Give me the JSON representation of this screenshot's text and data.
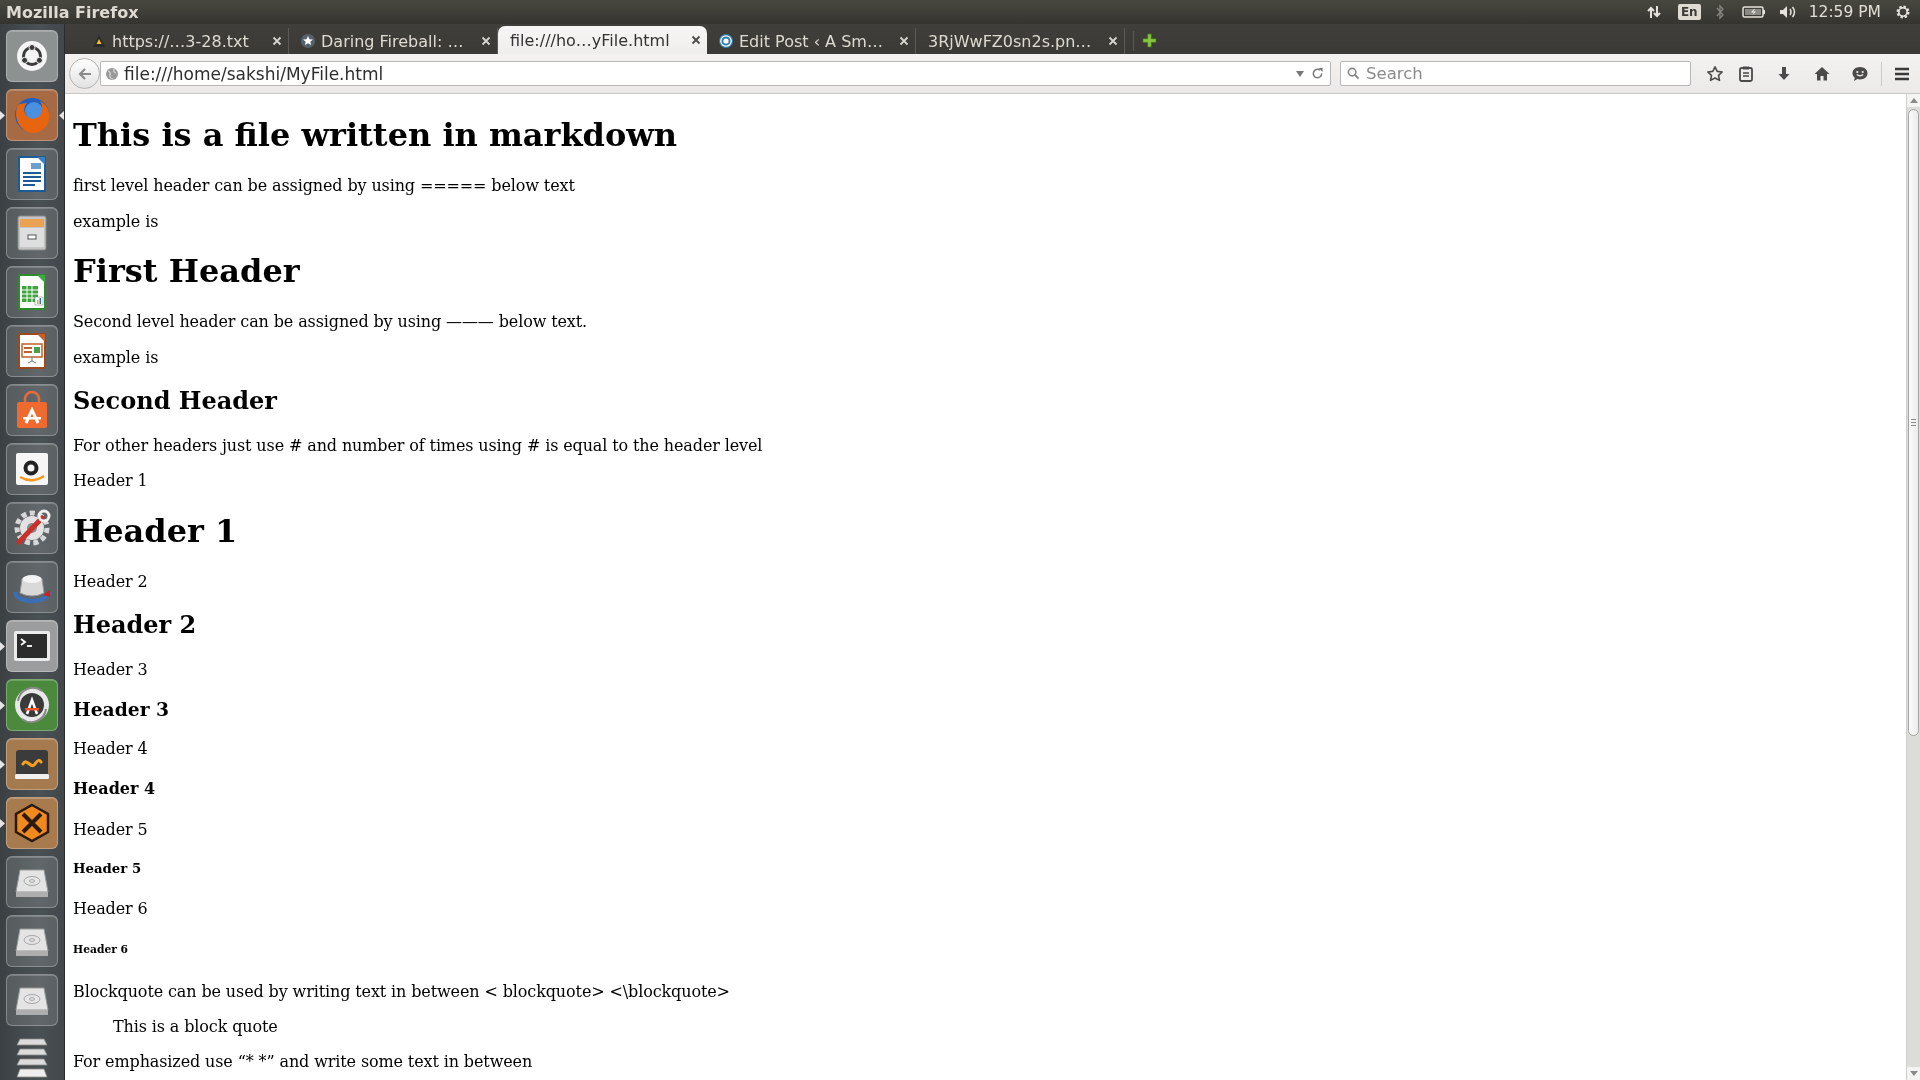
{
  "top_panel": {
    "title": "Mozilla Firefox",
    "keyboard_layout": "En",
    "time": "12:59 PM"
  },
  "launcher": [
    {
      "running": false,
      "focused": false
    },
    {
      "running": true,
      "focused": true
    },
    {
      "running": false,
      "focused": false
    },
    {
      "running": false,
      "focused": false
    },
    {
      "running": false,
      "focused": false
    },
    {
      "running": false,
      "focused": false
    },
    {
      "running": false,
      "focused": false
    },
    {
      "running": false,
      "focused": false
    },
    {
      "running": false,
      "focused": false
    },
    {
      "running": false,
      "focused": false
    },
    {
      "running": true,
      "focused": false
    },
    {
      "running": true,
      "focused": false
    },
    {
      "running": true,
      "focused": false
    },
    {
      "running": true,
      "focused": false
    },
    {
      "running": false,
      "focused": false
    },
    {
      "running": false,
      "focused": false
    },
    {
      "running": false,
      "focused": false
    },
    {
      "running": false,
      "focused": false
    }
  ],
  "tabs": [
    {
      "title": "https://…3-28.txt",
      "selected": false
    },
    {
      "title": "Daring Fireball: …",
      "selected": false
    },
    {
      "title": "file:///ho…yFile.html",
      "selected": true
    },
    {
      "title": "Edit Post ‹ A Sm…",
      "selected": false
    },
    {
      "title": "3RjWwFZ0sn2s.pn…",
      "selected": false
    }
  ],
  "address_bar": {
    "value": "file:///home/sakshi/MyFile.html"
  },
  "search": {
    "placeholder": "Search"
  },
  "page": {
    "blocks": [
      {
        "kind": "h1",
        "text": "This is a file written in markdown"
      },
      {
        "kind": "paragraph",
        "text": "first level header can be assigned by using ===== below text"
      },
      {
        "kind": "paragraph",
        "text": "example is"
      },
      {
        "kind": "h1",
        "text": "First Header"
      },
      {
        "kind": "paragraph",
        "text": "Second level header can be assigned by using ——— below text."
      },
      {
        "kind": "paragraph",
        "text": "example is"
      },
      {
        "kind": "h2",
        "text": "Second Header"
      },
      {
        "kind": "paragraph",
        "text": "For other headers just use # and number of times using # is equal to the header level"
      },
      {
        "kind": "paragraph",
        "text": "Header 1"
      },
      {
        "kind": "h1",
        "text": "Header 1"
      },
      {
        "kind": "paragraph",
        "text": "Header 2"
      },
      {
        "kind": "h2",
        "text": "Header 2"
      },
      {
        "kind": "paragraph",
        "text": "Header 3"
      },
      {
        "kind": "h3",
        "text": "Header 3"
      },
      {
        "kind": "paragraph",
        "text": "Header 4"
      },
      {
        "kind": "h4",
        "text": "Header 4"
      },
      {
        "kind": "paragraph",
        "text": "Header 5"
      },
      {
        "kind": "h5",
        "text": "Header 5"
      },
      {
        "kind": "paragraph",
        "text": "Header 6"
      },
      {
        "kind": "h6",
        "text": "Header 6"
      },
      {
        "kind": "paragraph",
        "text": "Blockquote can be used by writing text in between < blockquote> <\\blockquote>"
      },
      {
        "kind": "blockquote",
        "text": "This is a block quote"
      },
      {
        "kind": "paragraph",
        "text": "For emphasized use “* *” and write some text in between"
      }
    ]
  }
}
